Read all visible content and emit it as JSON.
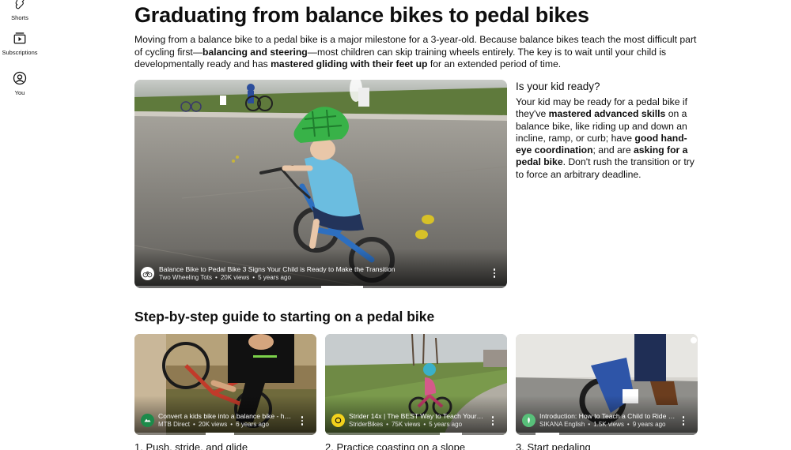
{
  "sidebar": {
    "items": [
      {
        "label": "Shorts"
      },
      {
        "label": "Subscriptions"
      },
      {
        "label": "You"
      }
    ]
  },
  "article": {
    "title": "Graduating from balance bikes to pedal bikes",
    "intro": {
      "p1": "Moving from a balance bike to a pedal bike is a major milestone for a 3-year-old. Because balance bikes teach the most difficult part of cycling first—",
      "b1": "balancing and steering",
      "p2": "—most children can skip training wheels entirely. The key is to wait until your child is developmentally ready and has ",
      "b2": "mastered gliding with their feet up",
      "p3": " for an extended period of time."
    },
    "featured_video": {
      "title": "Balance Bike to Pedal Bike 3 Signs Your Child is Ready to Make the Transition",
      "channel": "Two Wheeling Tots",
      "views": "20K views",
      "age": "5 years ago"
    },
    "ready": {
      "heading": "Is your kid ready?",
      "t1": "Your kid may be ready for a pedal bike if they've ",
      "b1": "mastered advanced skills",
      "t2": " on a balance bike, like riding up and down an incline, ramp, or curb; have ",
      "b2": "good hand-eye coordination",
      "t3": "; and are ",
      "b3": "asking for a pedal bike",
      "t4": ". Don't rush the transition or try to force an arbitrary deadline."
    },
    "guide_title": "Step-by-step guide to starting on a pedal bike",
    "videos": [
      {
        "title": "Convert a kids bike into a balance bike - hel…",
        "channel": "MTB Direct",
        "views": "20K views",
        "age": "6 years ago",
        "step": "1. Push, stride, and glide"
      },
      {
        "title": "Strider 14x | The BEST Way to Teach Your C…",
        "channel": "StriderBikes",
        "views": "75K views",
        "age": "5 years ago",
        "step": "2. Practice coasting on a slope"
      },
      {
        "title": "Introduction: How to Teach a Child to Ride a…",
        "channel": "SIKANA English",
        "views": "1.5K views",
        "age": "9 years ago",
        "step": "3. Start pedaling"
      }
    ]
  },
  "colors": {
    "text": "#0f0f0f",
    "overlay_text": "#ffffff",
    "meta_text": "#e6e6e6"
  },
  "icons": [
    "shorts-icon",
    "subscriptions-icon",
    "account-icon",
    "channel-avatar-icon",
    "more-vert-icon"
  ]
}
